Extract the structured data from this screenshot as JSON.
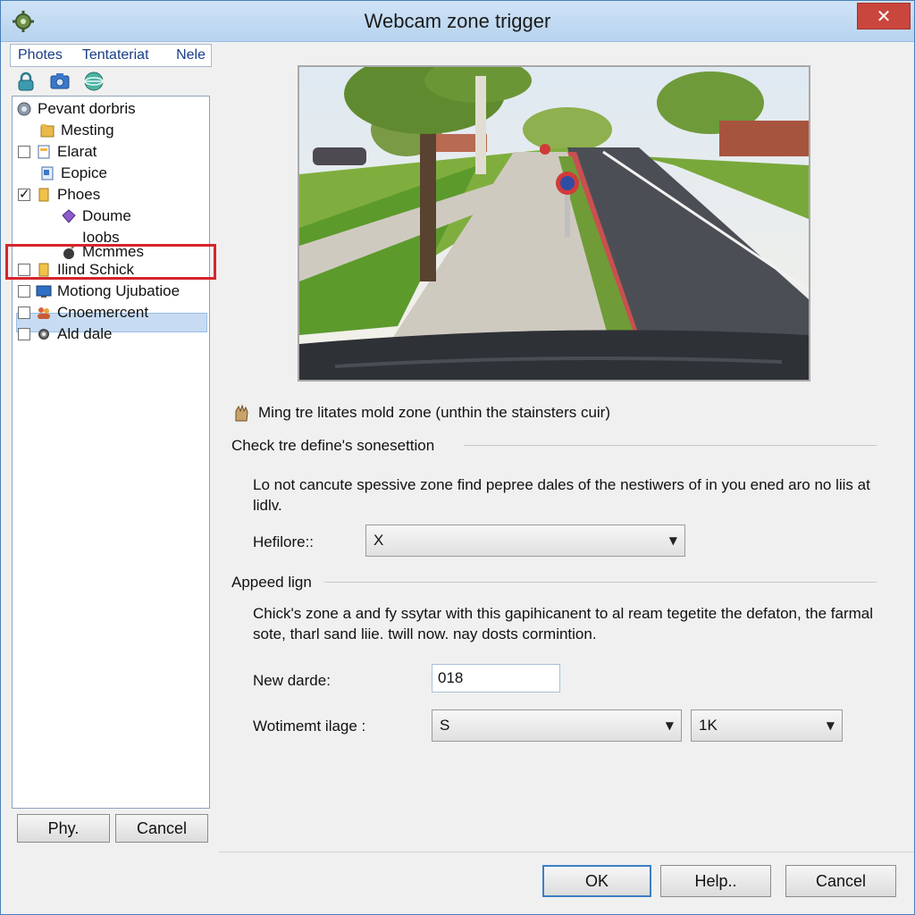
{
  "window": {
    "title": "Webcam zone trigger",
    "close_label": "✕"
  },
  "left_pane": {
    "tabs": [
      "Photes",
      "Tentateriat",
      "Nele"
    ],
    "toolbar_icons": [
      "lock-icon",
      "camera-icon",
      "globe-icon"
    ],
    "tree": [
      {
        "label": "Pevant dorbris",
        "checkbox": false,
        "checked": false,
        "icon": "camera-icon",
        "indent": 0
      },
      {
        "label": "Mesting",
        "checkbox": false,
        "checked": false,
        "icon": "folder-icon",
        "indent": 1
      },
      {
        "label": "Elarat",
        "checkbox": true,
        "checked": false,
        "icon": "document-icon",
        "indent": 0
      },
      {
        "label": "Eopice",
        "checkbox": false,
        "checked": false,
        "icon": "document-icon",
        "indent": 1
      },
      {
        "label": "Phoes",
        "checkbox": true,
        "checked": true,
        "icon": "folder-icon",
        "indent": 0
      },
      {
        "label": "Doume",
        "checkbox": false,
        "checked": false,
        "icon": "gem-icon",
        "indent": 2
      },
      {
        "label": "Ioobs",
        "checkbox": false,
        "checked": false,
        "icon": "",
        "indent": 2
      },
      {
        "label": "Mcmmes",
        "checkbox": false,
        "checked": false,
        "icon": "bomb-icon",
        "indent": 2
      },
      {
        "label": "Ilind Schick",
        "checkbox": true,
        "checked": false,
        "icon": "folder-icon",
        "indent": 0,
        "selected": true
      },
      {
        "label": "Motiong Ujubatioe",
        "checkbox": true,
        "checked": false,
        "icon": "monitor-icon",
        "indent": 0
      },
      {
        "label": "Cnoemercent",
        "checkbox": true,
        "checked": false,
        "icon": "people-icon",
        "indent": 0
      },
      {
        "label": "Ald dale",
        "checkbox": true,
        "checked": false,
        "icon": "gear-icon",
        "indent": 0
      }
    ],
    "buttons": {
      "apply": "Phy.",
      "cancel": "Cancel"
    }
  },
  "main": {
    "info_text": "Ming tre litates mold zone (unthin the stainsters cuir)",
    "section1": {
      "heading": "Check tre define's sonesettion",
      "description": "Lo not cancute spessive zone find pepree dales of the nestiwers of in you ened aro no liis at lidlv.",
      "field_label": "Hefilore::",
      "field_value": "X"
    },
    "section2": {
      "heading": "Appeed lign",
      "description": "Chick's zone a and fy ssytar with this gapihicanent to al ream tegetite the defaton, the farmal sote, tharl sand liie. twill now. nay dosts cormintion.",
      "new_label": "New darde:",
      "new_value": "018",
      "wot_label": "Wotimemt ilage :",
      "wot_value1": "S",
      "wot_value2": "1K"
    }
  },
  "footer": {
    "ok": "OK",
    "help": "Help..",
    "cancel": "Cancel"
  }
}
